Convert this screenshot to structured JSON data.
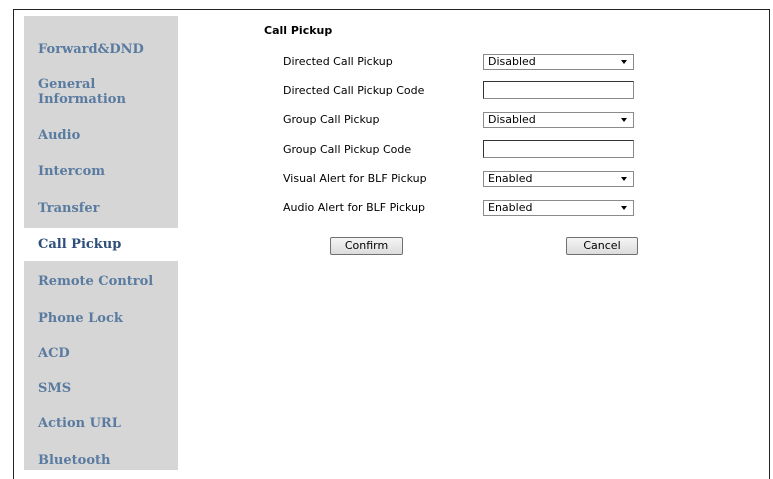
{
  "sidebar": {
    "items": [
      {
        "label": "Forward&DND"
      },
      {
        "label": "General\nInformation"
      },
      {
        "label": "Audio"
      },
      {
        "label": "Intercom"
      },
      {
        "label": "Transfer"
      },
      {
        "label": "Call Pickup"
      },
      {
        "label": "Remote Control"
      },
      {
        "label": "Phone Lock"
      },
      {
        "label": "ACD"
      },
      {
        "label": "SMS"
      },
      {
        "label": "Action URL"
      },
      {
        "label": "Bluetooth"
      }
    ],
    "active_index": 5
  },
  "section": {
    "title": "Call Pickup",
    "fields": [
      {
        "label": "Directed Call Pickup",
        "type": "select",
        "value": "Disabled"
      },
      {
        "label": "Directed Call Pickup Code",
        "type": "text",
        "value": ""
      },
      {
        "label": "Group Call Pickup",
        "type": "select",
        "value": "Disabled"
      },
      {
        "label": "Group Call Pickup Code",
        "type": "text",
        "value": ""
      },
      {
        "label": "Visual Alert for BLF Pickup",
        "type": "select",
        "value": "Enabled"
      },
      {
        "label": "Audio Alert for BLF Pickup",
        "type": "select",
        "value": "Enabled"
      }
    ]
  },
  "buttons": {
    "confirm": "Confirm",
    "cancel": "Cancel"
  }
}
